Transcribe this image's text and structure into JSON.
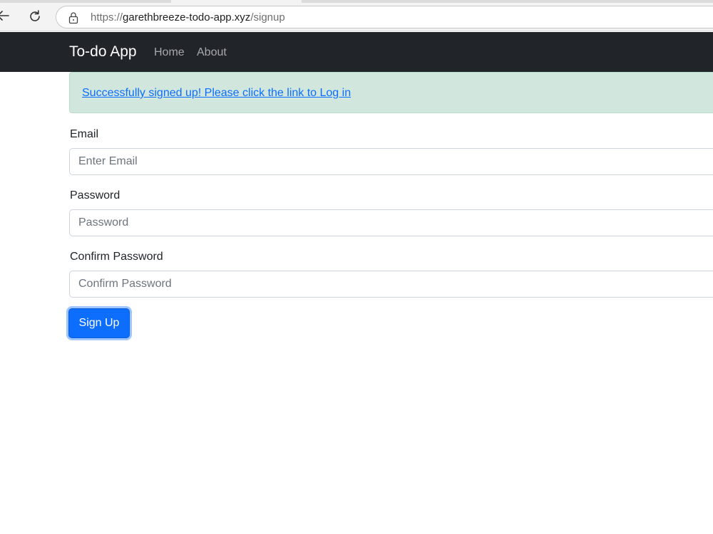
{
  "browser": {
    "url_prefix": "https://",
    "url_host": "garethbreeze-todo-app.xyz",
    "url_path": "/signup"
  },
  "navbar": {
    "brand": "To-do App",
    "links": [
      {
        "label": "Home"
      },
      {
        "label": "About"
      }
    ],
    "background": "#212529"
  },
  "alert": {
    "message": "Successfully signed up! Please click the link to Log in",
    "background": "#d1e7dd",
    "link_color": "#0d6efd"
  },
  "form": {
    "email": {
      "label": "Email",
      "placeholder": "Enter Email",
      "value": ""
    },
    "password": {
      "label": "Password",
      "placeholder": "Password",
      "value": ""
    },
    "confirm_password": {
      "label": "Confirm Password",
      "placeholder": "Confirm Password",
      "value": ""
    },
    "submit_label": "Sign Up",
    "submit_color": "#0d6efd"
  },
  "icons": {
    "back": "back-arrow-icon",
    "reload": "reload-icon",
    "site_info": "lock-icon"
  }
}
